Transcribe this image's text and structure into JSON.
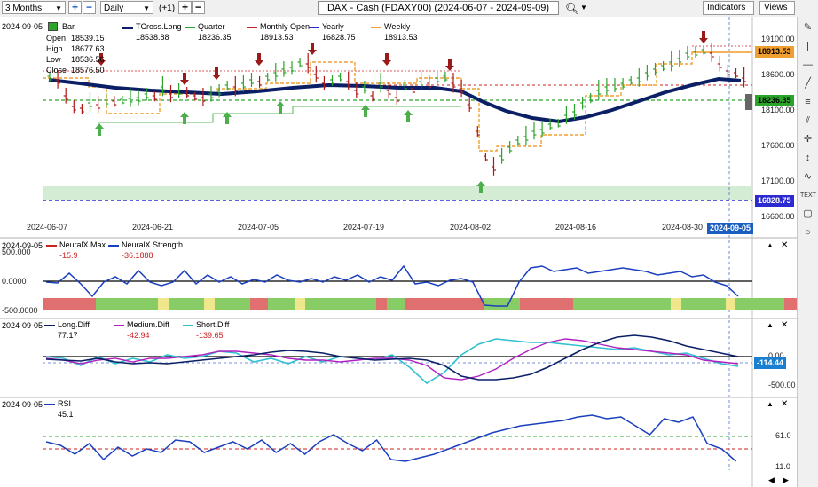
{
  "toolbar": {
    "period": "3 Months",
    "interval": "Daily",
    "offset": "(+1)",
    "title": "DAX - Cash (FDAXY00) (2024-06-07 - 2024-09-09)",
    "indicators_label": "Indicators",
    "views_label": "Views"
  },
  "main_panel": {
    "date_label": "2024-09-05",
    "bar_label": "Bar",
    "ohlc": {
      "open_label": "Open",
      "open": "18539.15",
      "high_label": "High",
      "high": "18677.63",
      "low_label": "Low",
      "low": "18536.56",
      "close_label": "Close",
      "close": "18576.50"
    },
    "legend": [
      {
        "name": "TCross.Long",
        "value": "18538.88",
        "color": "#0a1f66"
      },
      {
        "name": "Quarter",
        "value": "18236.35",
        "color": "#2aa52a"
      },
      {
        "name": "Monthly Open",
        "value": "18913.53",
        "color": "#cc2222"
      },
      {
        "name": "Yearly",
        "value": "16828.75",
        "color": "#2a2ad0"
      },
      {
        "name": "Weekly",
        "value": "18913.53",
        "color": "#f0a030"
      }
    ],
    "y_ticks": [
      "19100.00",
      "18600.00",
      "18100.00",
      "17600.00",
      "17100.00",
      "16600.00"
    ],
    "x_ticks": [
      "2024-06-07",
      "2024-06-21",
      "2024-07-05",
      "2024-07-19",
      "2024-08-02",
      "2024-08-16",
      "2024-08-30"
    ],
    "current_date_tag": "2024-09-05",
    "price_tags": {
      "weekly": "18913.53",
      "quarter": "18236.35",
      "yearly": "16828.75"
    }
  },
  "neuralx_panel": {
    "date_label": "2024-09-05",
    "legend": [
      {
        "name": "NeuralX.Max",
        "value": "-15.9",
        "color": "#cc2222"
      },
      {
        "name": "NeuralX.Strength",
        "value": "-36.1888",
        "color": "#1a3fbf"
      }
    ],
    "y_ticks": [
      "500.000",
      "0.0000",
      "-500.0000"
    ]
  },
  "diff_panel": {
    "date_label": "2024-09-05",
    "legend": [
      {
        "name": "Long.Diff",
        "value": "77.17",
        "color": "#0a1f66"
      },
      {
        "name": "Medium.Diff",
        "value": "-42.94",
        "color": "#b020c0"
      },
      {
        "name": "Short.Diff",
        "value": "-139.65",
        "color": "#30c0d0"
      }
    ],
    "y_ticks": [
      "0.00",
      "-500.00"
    ],
    "current_tag": "-114.44"
  },
  "rsi_panel": {
    "date_label": "2024-09-05",
    "legend": [
      {
        "name": "RSI",
        "value": "45.1",
        "color": "#1a3fbf"
      }
    ],
    "y_ticks": [
      "61.0",
      "11.0"
    ]
  },
  "sidebar_icons": [
    "pencil-icon",
    "vertical-line-icon",
    "horizontal-line-icon",
    "trend-line-icon",
    "fibonacci-icon",
    "crosshair-icon",
    "measure-icon",
    "text-icon",
    "rectangle-icon",
    "circle-icon"
  ]
}
